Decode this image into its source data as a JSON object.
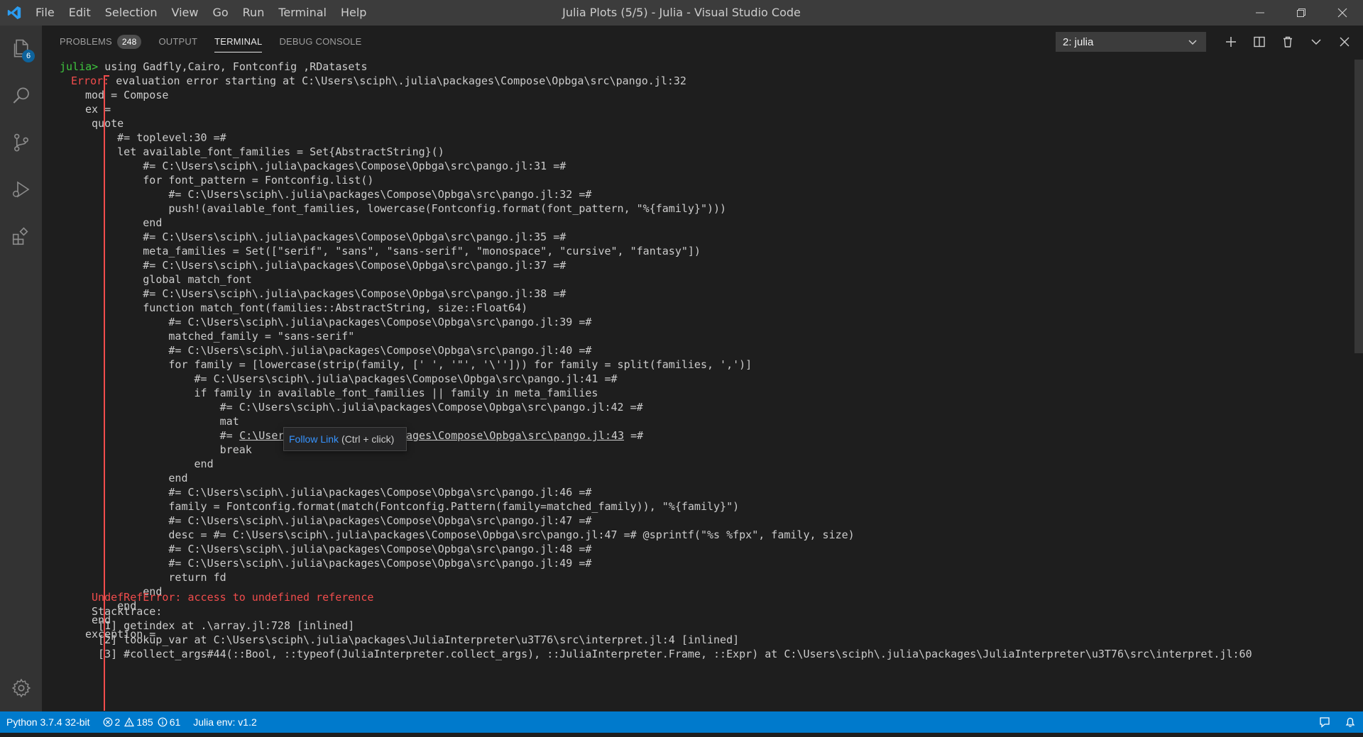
{
  "window": {
    "title": "Julia Plots (5/5) - Julia - Visual Studio Code",
    "menu": [
      "File",
      "Edit",
      "Selection",
      "View",
      "Go",
      "Run",
      "Terminal",
      "Help"
    ]
  },
  "activity_bar": {
    "explorer_badge": "6",
    "icons": [
      "files-icon",
      "search-icon",
      "source-control-icon",
      "run-debug-icon",
      "extensions-icon",
      "gear-icon"
    ]
  },
  "panel": {
    "tabs": [
      {
        "label": "PROBLEMS",
        "count": "248"
      },
      {
        "label": "OUTPUT"
      },
      {
        "label": "TERMINAL",
        "active": true
      },
      {
        "label": "DEBUG CONSOLE"
      }
    ],
    "terminal_selector": "2: julia"
  },
  "terminal": {
    "prompt": "julia>",
    "command": " using Gadfly,Cairo, Fontconfig ,RDatasets",
    "error_prefix": "Error:",
    "error_message": " evaluation error starting at C:\\Users\\sciph\\.julia\\packages\\Compose\\Opbga\\src\\pango.jl:32",
    "lines": [
      "mod = Compose",
      "ex =",
      " quote",
      "     #= toplevel:30 =#",
      "     let available_font_families = Set{AbstractString}()",
      "         #= C:\\Users\\sciph\\.julia\\packages\\Compose\\Opbga\\src\\pango.jl:31 =#",
      "         for font_pattern = Fontconfig.list()",
      "             #= C:\\Users\\sciph\\.julia\\packages\\Compose\\Opbga\\src\\pango.jl:32 =#",
      "             push!(available_font_families, lowercase(Fontconfig.format(font_pattern, \"%{family}\")))",
      "         end",
      "         #= C:\\Users\\sciph\\.julia\\packages\\Compose\\Opbga\\src\\pango.jl:35 =#",
      "         meta_families = Set([\"serif\", \"sans\", \"sans-serif\", \"monospace\", \"cursive\", \"fantasy\"])",
      "         #= C:\\Users\\sciph\\.julia\\packages\\Compose\\Opbga\\src\\pango.jl:37 =#",
      "         global match_font",
      "         #= C:\\Users\\sciph\\.julia\\packages\\Compose\\Opbga\\src\\pango.jl:38 =#",
      "         function match_font(families::AbstractString, size::Float64)",
      "             #= C:\\Users\\sciph\\.julia\\packages\\Compose\\Opbga\\src\\pango.jl:39 =#",
      "             matched_family = \"sans-serif\"",
      "             #= C:\\Users\\sciph\\.julia\\packages\\Compose\\Opbga\\src\\pango.jl:40 =#",
      "             for family = [lowercase(strip(family, [' ', '\"', '\\''])) for family = split(families, ',')]",
      "                 #= C:\\Users\\sciph\\.julia\\packages\\Compose\\Opbga\\src\\pango.jl:41 =#",
      "                 if family in available_font_families || family in meta_families",
      "                     #= C:\\Users\\sciph\\.julia\\packages\\Compose\\Opbga\\src\\pango.jl:42 =#",
      "                     mat",
      "                     #= ",
      "                     break",
      "                 end",
      "             end",
      "             #= C:\\Users\\sciph\\.julia\\packages\\Compose\\Opbga\\src\\pango.jl:46 =#",
      "             family = Fontconfig.format(match(Fontconfig.Pattern(family=matched_family)), \"%{family}\")",
      "             #= C:\\Users\\sciph\\.julia\\packages\\Compose\\Opbga\\src\\pango.jl:47 =#",
      "             desc = #= C:\\Users\\sciph\\.julia\\packages\\Compose\\Opbga\\src\\pango.jl:47 =# @sprintf(\"%s %fpx\", family, size)",
      "             #= C:\\Users\\sciph\\.julia\\packages\\Compose\\Opbga\\src\\pango.jl:48 =#",
      "             #= C:\\Users\\sciph\\.julia\\packages\\Compose\\Opbga\\src\\pango.jl:49 =#",
      "             return fd",
      "         end",
      "     end",
      " end",
      "exception ="
    ],
    "link_line_suffix_link": "C:\\Users\\sciph\\.julia\\packages\\Compose\\Opbga\\src\\pango.jl:43",
    "link_line_suffix_end": " =#",
    "exception_error": " UndefRefError: access to undefined reference",
    "stacktrace_label": " Stacktrace:",
    "stacktrace": [
      "  [1] getindex at .\\array.jl:728 [inlined]",
      "  [2] lookup_var at C:\\Users\\sciph\\.julia\\packages\\JuliaInterpreter\\u3T76\\src\\interpret.jl:4 [inlined]",
      "  [3] #collect_args#44(::Bool, ::typeof(JuliaInterpreter.collect_args), ::JuliaInterpreter.Frame, ::Expr) at C:\\Users\\sciph\\.julia\\packages\\JuliaInterpreter\\u3T76\\src\\interpret.jl:60"
    ],
    "tooltip_link": "Follow Link",
    "tooltip_hint": "(Ctrl + click)"
  },
  "status_bar": {
    "python": "Python 3.7.4 32-bit",
    "errors": "2",
    "warnings": "185",
    "infos": "61",
    "julia_env": "Julia env: v1.2"
  },
  "colors": {
    "accent": "#007acc",
    "prompt_green": "#3ec53e",
    "error_red": "#f14c4c",
    "link_blue": "#3794ff"
  }
}
